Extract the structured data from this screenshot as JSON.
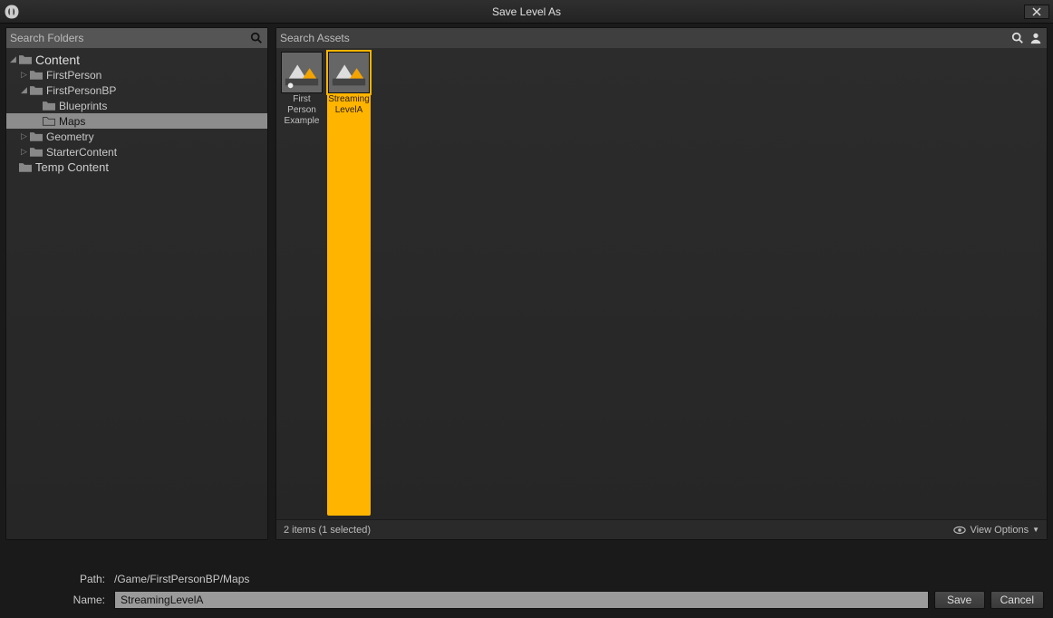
{
  "window": {
    "title": "Save Level As"
  },
  "search": {
    "folders_placeholder": "Search Folders",
    "assets_placeholder": "Search Assets"
  },
  "tree": {
    "content": "Content",
    "firstperson": "FirstPerson",
    "firstpersonbp": "FirstPersonBP",
    "blueprints": "Blueprints",
    "maps": "Maps",
    "geometry": "Geometry",
    "startercontent": "StarterContent",
    "tempcontent": "Temp Content"
  },
  "assets": [
    {
      "name": "First Person Example"
    },
    {
      "name": "Streaming LevelA"
    }
  ],
  "status": {
    "count_text": "2 items (1 selected)",
    "view_options": "View Options"
  },
  "form": {
    "path_label": "Path:",
    "path_value": "/Game/FirstPersonBP/Maps",
    "name_label": "Name:",
    "name_value": "StreamingLevelA",
    "save": "Save",
    "cancel": "Cancel"
  }
}
